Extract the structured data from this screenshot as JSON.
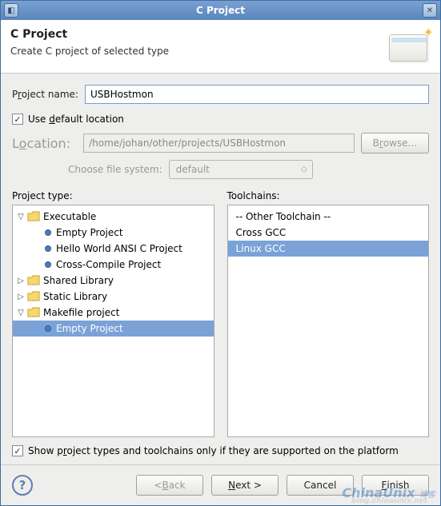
{
  "titlebar": {
    "title": "C Project"
  },
  "banner": {
    "title": "C Project",
    "subtitle": "Create C project of selected type"
  },
  "form": {
    "project_name_label_pre": "P",
    "project_name_label_u": "r",
    "project_name_label_post": "oject name:",
    "project_name_value": "USBHostmon",
    "use_default_pre": "Use ",
    "use_default_u": "d",
    "use_default_post": "efault location",
    "location_label_pre": "L",
    "location_label_u": "o",
    "location_label_post": "cation:",
    "location_value": "/home/johan/other/projects/USBHostmon",
    "browse_label_pre": "B",
    "browse_label_u": "r",
    "browse_label_post": "owse...",
    "choose_fs_label": "Choose file system:",
    "choose_fs_value": "default"
  },
  "lists": {
    "project_type_label": "Project type:",
    "toolchains_label": "Toolchains:",
    "tree": [
      {
        "depth": 0,
        "expander": "▽",
        "kind": "folder",
        "label": "Executable",
        "selected": false
      },
      {
        "depth": 1,
        "expander": "",
        "kind": "bullet",
        "label": "Empty Project",
        "selected": false
      },
      {
        "depth": 1,
        "expander": "",
        "kind": "bullet",
        "label": "Hello World ANSI C Project",
        "selected": false
      },
      {
        "depth": 1,
        "expander": "",
        "kind": "bullet",
        "label": "Cross-Compile Project",
        "selected": false
      },
      {
        "depth": 0,
        "expander": "▷",
        "kind": "folder",
        "label": "Shared Library",
        "selected": false
      },
      {
        "depth": 0,
        "expander": "▷",
        "kind": "folder",
        "label": "Static Library",
        "selected": false
      },
      {
        "depth": 0,
        "expander": "▽",
        "kind": "folder",
        "label": "Makefile project",
        "selected": false
      },
      {
        "depth": 1,
        "expander": "",
        "kind": "bullet",
        "label": "Empty Project",
        "selected": true
      }
    ],
    "toolchains": [
      {
        "label": "-- Other Toolchain --",
        "selected": false
      },
      {
        "label": "Cross GCC",
        "selected": false
      },
      {
        "label": "Linux GCC",
        "selected": true
      }
    ]
  },
  "footer_check": {
    "pre": "Show p",
    "u": "r",
    "post": "oject types and toolchains only if they are supported on the platform"
  },
  "buttons": {
    "back_pre": "< ",
    "back_u": "B",
    "back_post": "ack",
    "next_u": "N",
    "next_post": "ext >",
    "cancel": "Cancel",
    "finish_u": "F",
    "finish_post": "inish"
  },
  "watermark": {
    "main": "ChinaUnix",
    "sub": "博客",
    "url": "blog.chinaunix.net"
  }
}
